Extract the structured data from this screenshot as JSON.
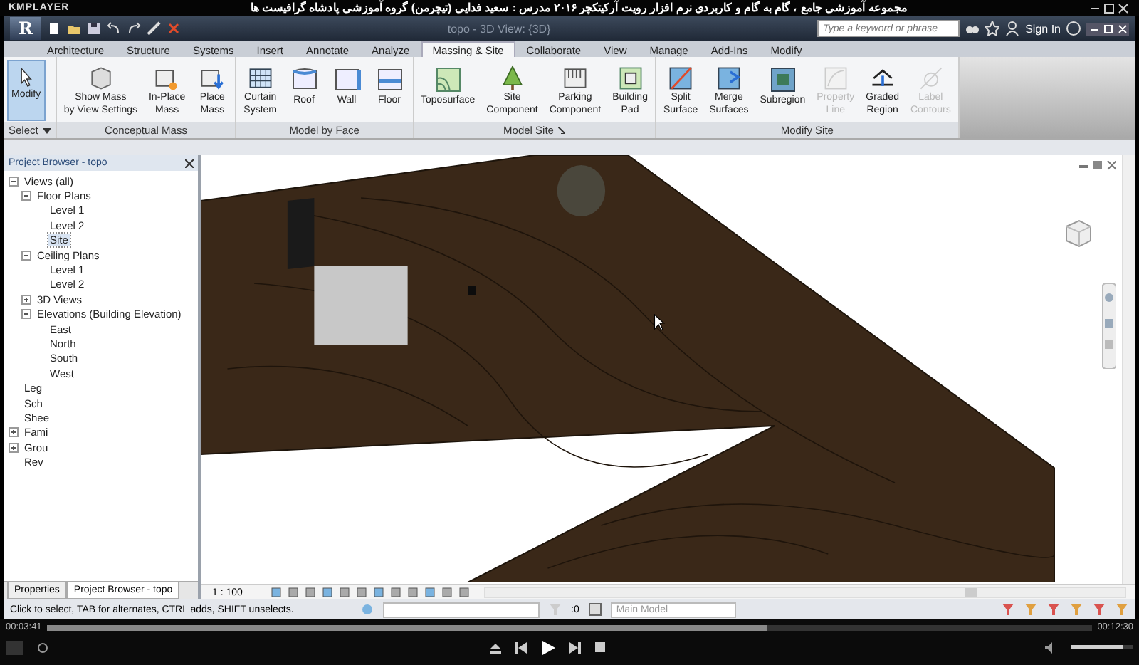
{
  "player": {
    "brand": "KMPLAYER",
    "title": "مجموعه آموزشی جامع ، گام به گام و کاربردی نرم افزار رویت آرکیتکچر ۲۰۱۶   مدرس : سعید فدایی (تیچرمن) گروه آموزشی پادشاه گرافیست ها",
    "elapsed": "00:03:41",
    "total": "00:12:30",
    "progress": {
      "level": 0.69
    },
    "volume": {
      "level": 0.85
    }
  },
  "app": {
    "logo": "R",
    "document_title": "topo - 3D View: {3D}",
    "search": {
      "placeholder": "Type a keyword or phrase"
    },
    "sign_in": "Sign In"
  },
  "tabs": [
    {
      "label": "Architecture",
      "selected": false
    },
    {
      "label": "Structure",
      "selected": false
    },
    {
      "label": "Systems",
      "selected": false
    },
    {
      "label": "Insert",
      "selected": false
    },
    {
      "label": "Annotate",
      "selected": false
    },
    {
      "label": "Analyze",
      "selected": false
    },
    {
      "label": "Massing & Site",
      "selected": true
    },
    {
      "label": "Collaborate",
      "selected": false
    },
    {
      "label": "View",
      "selected": false
    },
    {
      "label": "Manage",
      "selected": false
    },
    {
      "label": "Add-Ins",
      "selected": false
    },
    {
      "label": "Modify",
      "selected": false
    }
  ],
  "ribbon": [
    {
      "title": "Select",
      "dropdown": true,
      "tools": [
        {
          "kind": "cursor",
          "lines": [
            "Modify"
          ],
          "selected": true,
          "disabled": false
        }
      ]
    },
    {
      "title": "Conceptual Mass",
      "tools": [
        {
          "kind": "mass",
          "lines": [
            "Show Mass",
            "by View Settings"
          ],
          "selected": false,
          "disabled": false
        },
        {
          "kind": "inplace",
          "lines": [
            "In-Place",
            "Mass"
          ],
          "selected": false,
          "disabled": false
        },
        {
          "kind": "place",
          "lines": [
            "Place",
            "Mass"
          ],
          "selected": false,
          "disabled": false
        }
      ]
    },
    {
      "title": "Model by Face",
      "tools": [
        {
          "kind": "grid",
          "lines": [
            "Curtain",
            "System"
          ],
          "selected": false,
          "disabled": false
        },
        {
          "kind": "roof",
          "lines": [
            "Roof"
          ],
          "selected": false,
          "disabled": false
        },
        {
          "kind": "wall",
          "lines": [
            "Wall"
          ],
          "selected": false,
          "disabled": false
        },
        {
          "kind": "floor",
          "lines": [
            "Floor"
          ],
          "selected": false,
          "disabled": false
        }
      ]
    },
    {
      "title": "Model Site",
      "launcher": true,
      "tools": [
        {
          "kind": "topo",
          "lines": [
            "Toposurface"
          ],
          "selected": false,
          "disabled": false
        },
        {
          "kind": "tree",
          "lines": [
            "Site",
            "Component"
          ],
          "selected": false,
          "disabled": false
        },
        {
          "kind": "parking",
          "lines": [
            "Parking",
            "Component"
          ],
          "selected": false,
          "disabled": false
        },
        {
          "kind": "pad",
          "lines": [
            "Building",
            "Pad"
          ],
          "selected": false,
          "disabled": false
        }
      ]
    },
    {
      "title": "Modify Site",
      "tools": [
        {
          "kind": "split",
          "lines": [
            "Split",
            "Surface"
          ],
          "selected": false,
          "disabled": false
        },
        {
          "kind": "merge",
          "lines": [
            "Merge",
            "Surfaces"
          ],
          "selected": false,
          "disabled": false
        },
        {
          "kind": "subregion",
          "lines": [
            "Subregion"
          ],
          "selected": false,
          "disabled": false
        },
        {
          "kind": "propline",
          "lines": [
            "Property",
            "Line"
          ],
          "selected": false,
          "disabled": true
        },
        {
          "kind": "graded",
          "lines": [
            "Graded",
            "Region"
          ],
          "selected": false,
          "disabled": false
        },
        {
          "kind": "contour",
          "lines": [
            "Label",
            "Contours"
          ],
          "selected": false,
          "disabled": true
        }
      ]
    }
  ],
  "browser": {
    "title": "Project Browser - topo",
    "tree": [
      {
        "label": "Views (all)",
        "expanded": true,
        "selected": false,
        "children": [
          {
            "label": "Floor Plans",
            "expanded": true,
            "selected": false,
            "children": [
              {
                "label": "Level 1",
                "selected": false
              },
              {
                "label": "Level 2",
                "selected": false
              },
              {
                "label": "Site",
                "selected": true
              }
            ]
          },
          {
            "label": "Ceiling Plans",
            "expanded": true,
            "selected": false,
            "children": [
              {
                "label": "Level 1",
                "selected": false
              },
              {
                "label": "Level 2",
                "selected": false
              }
            ]
          },
          {
            "label": "3D Views",
            "expanded": false,
            "selected": false
          },
          {
            "label": "Elevations (Building Elevation)",
            "expanded": true,
            "selected": false,
            "children": [
              {
                "label": "East",
                "selected": false
              },
              {
                "label": "North",
                "selected": false
              },
              {
                "label": "South",
                "selected": false
              },
              {
                "label": "West",
                "selected": false
              }
            ]
          }
        ]
      },
      {
        "label": "Leg",
        "selected": false
      },
      {
        "label": "Sch",
        "selected": false
      },
      {
        "label": "Shee",
        "selected": false
      },
      {
        "label": "Fami",
        "expanded": false,
        "selected": false
      },
      {
        "label": "Grou",
        "expanded": false,
        "selected": false
      },
      {
        "label": "Rev",
        "selected": false
      }
    ],
    "tabs": [
      {
        "label": "Properties",
        "selected": false
      },
      {
        "label": "Project Browser - topo",
        "selected": true
      }
    ]
  },
  "view_bar": {
    "scale": "1 : 100"
  },
  "status": {
    "message": "Click to select, TAB for alternates, CTRL adds, SHIFT unselects.",
    "count": ":0",
    "workset": "Main Model"
  }
}
